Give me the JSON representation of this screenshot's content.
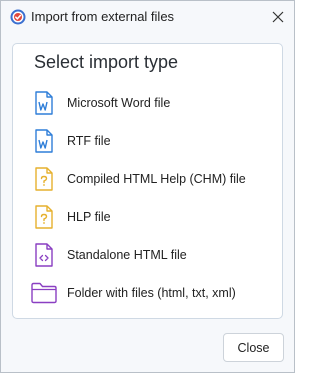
{
  "window": {
    "title": "Import from external files",
    "icon": "app-logo-icon"
  },
  "panel": {
    "heading": "Select import type"
  },
  "items": [
    {
      "label": "Microsoft Word file",
      "icon": "word-file-icon",
      "color": "#2f7ed8"
    },
    {
      "label": "RTF file",
      "icon": "rtf-file-icon",
      "color": "#2f7ed8"
    },
    {
      "label": "Compiled HTML Help (CHM) file",
      "icon": "chm-file-icon",
      "color": "#e6b12e"
    },
    {
      "label": "HLP file",
      "icon": "hlp-file-icon",
      "color": "#e6b12e"
    },
    {
      "label": "Standalone HTML file",
      "icon": "html-file-icon",
      "color": "#8a3fc2"
    },
    {
      "label": "Folder with files (html, txt, xml)",
      "icon": "folder-icon",
      "color": "#8a3fc2"
    }
  ],
  "footer": {
    "close_label": "Close"
  }
}
